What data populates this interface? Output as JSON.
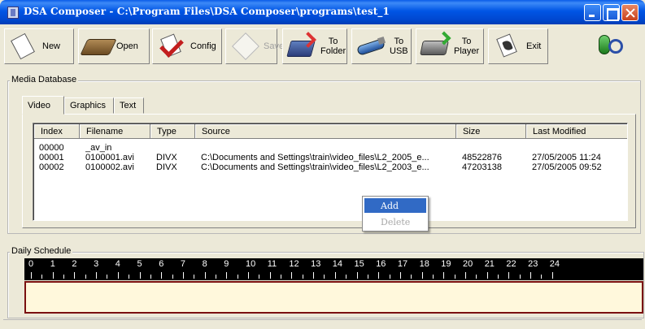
{
  "window": {
    "title": "DSA Composer - C:\\Program Files\\DSA Composer\\programs\\test_1"
  },
  "toolbar": {
    "new_label": "New",
    "open_label": "Open",
    "config_label": "Config",
    "save_label": "Save",
    "to_folder_label": "To\nFolder",
    "to_usb_label": "To\nUSB",
    "to_player_label": "To\nPlayer",
    "exit_label": "Exit"
  },
  "media_database": {
    "label": "Media Database",
    "tabs": [
      {
        "label": "Video",
        "active": true
      },
      {
        "label": "Graphics",
        "active": false
      },
      {
        "label": "Text",
        "active": false
      }
    ],
    "columns": [
      "Index",
      "Filename",
      "Type",
      "Source",
      "Size",
      "Last Modified"
    ],
    "rows": [
      {
        "index": "00000",
        "filename": "_av_in",
        "type": "",
        "source": "",
        "size": "",
        "modified": ""
      },
      {
        "index": "00001",
        "filename": "0100001.avi",
        "type": "DIVX",
        "source": "C:\\Documents and Settings\\train\\video_files\\L2_2005_e...",
        "size": "48522876",
        "modified": "27/05/2005 11:24"
      },
      {
        "index": "00002",
        "filename": "0100002.avi",
        "type": "DIVX",
        "source": "C:\\Documents and Settings\\train\\video_files\\L2_2003_e...",
        "size": "47203138",
        "modified": "27/05/2005 09:52"
      }
    ]
  },
  "context_menu": {
    "items": [
      {
        "label": "Add",
        "enabled": true,
        "highlighted": true
      },
      {
        "label": "Delete",
        "enabled": false,
        "highlighted": false
      }
    ]
  },
  "daily_schedule": {
    "label": "Daily Schedule",
    "hours": [
      "0",
      "1",
      "2",
      "3",
      "4",
      "5",
      "6",
      "7",
      "8",
      "9",
      "10",
      "11",
      "12",
      "13",
      "14",
      "15",
      "16",
      "17",
      "18",
      "19",
      "20",
      "21",
      "22",
      "23",
      "24"
    ],
    "track_color": "#fff8dc",
    "track_border_color": "#7a1010"
  },
  "colors": {
    "titlebar_blue": "#0055e5",
    "selection_blue": "#316ac5",
    "window_bg": "#ece9d8"
  }
}
